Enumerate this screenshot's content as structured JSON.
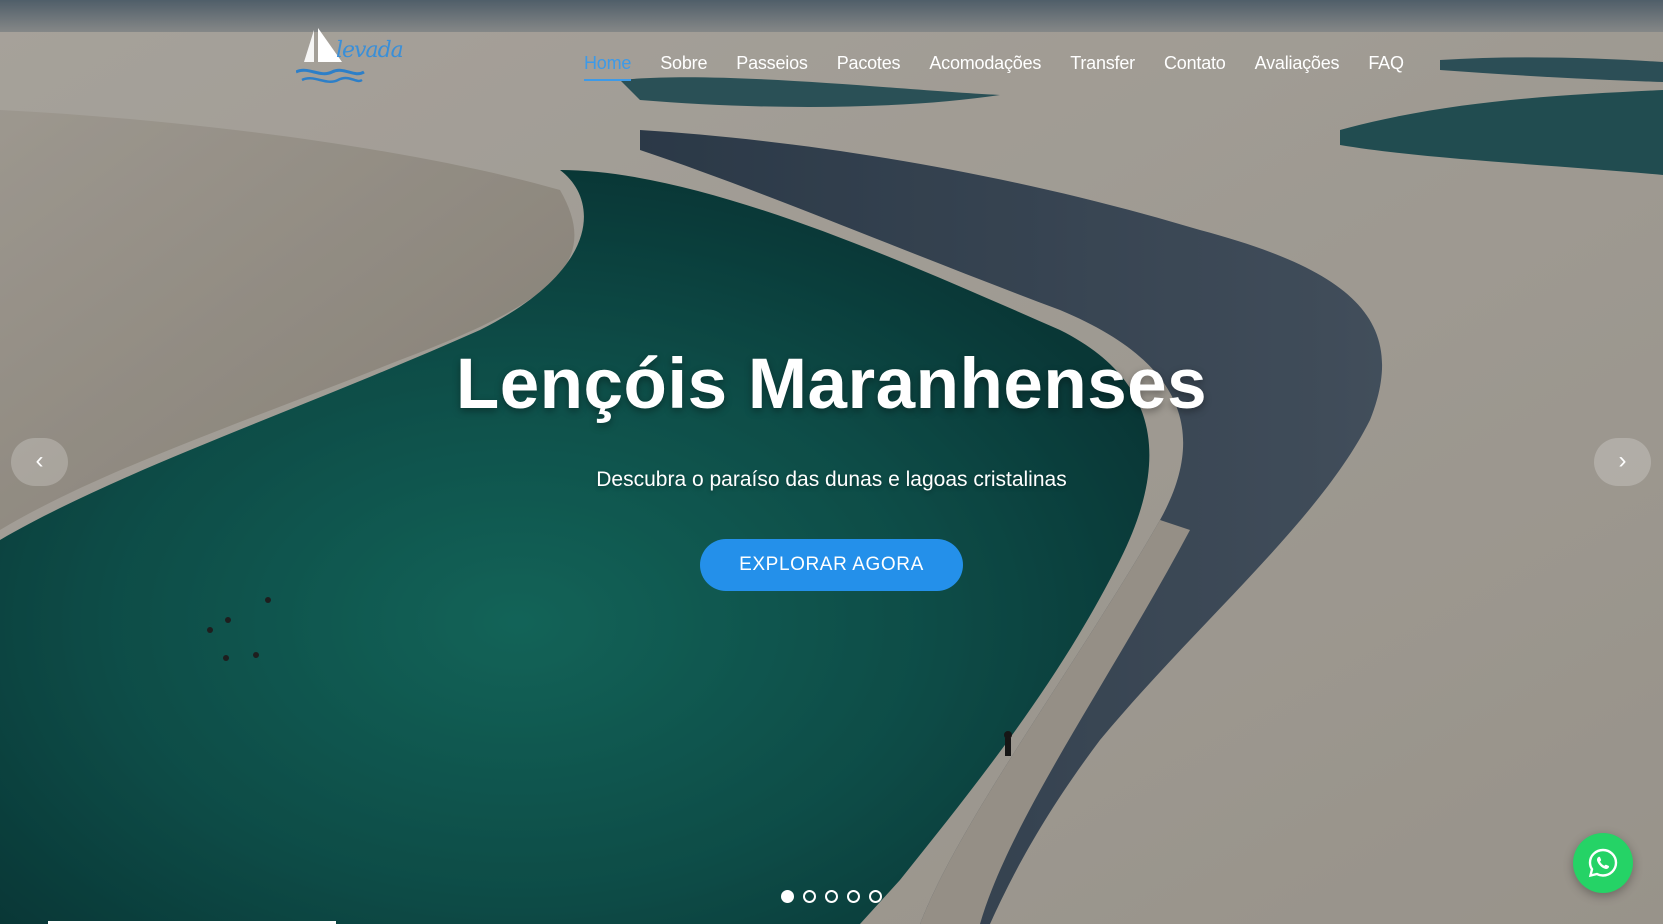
{
  "brand": {
    "logo_text": "levada"
  },
  "nav": {
    "items": [
      {
        "label": "Home",
        "active": true
      },
      {
        "label": "Sobre",
        "active": false
      },
      {
        "label": "Passeios",
        "active": false
      },
      {
        "label": "Pacotes",
        "active": false
      },
      {
        "label": "Acomodações",
        "active": false
      },
      {
        "label": "Transfer",
        "active": false
      },
      {
        "label": "Contato",
        "active": false
      },
      {
        "label": "Avaliações",
        "active": false
      },
      {
        "label": "FAQ",
        "active": false
      }
    ]
  },
  "hero": {
    "title": "Lençóis Maranhenses",
    "subtitle": "Descubra o paraíso das dunas e lagoas cristalinas",
    "cta_label": "EXPLORAR AGORA"
  },
  "carousel": {
    "prev_label": "‹",
    "next_label": "›",
    "slide_count": 5,
    "active_slide": 1
  },
  "icons": {
    "whatsapp": "whatsapp-icon",
    "logo": "sailboat-logo-icon"
  },
  "colors": {
    "accent": "#2490ea",
    "nav_active": "#3d9ae8",
    "whatsapp": "#25d366"
  }
}
